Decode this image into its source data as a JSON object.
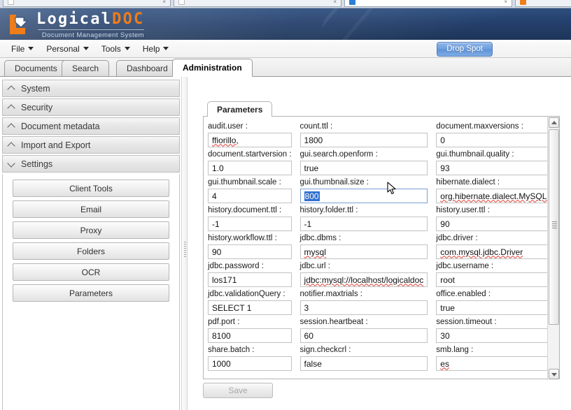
{
  "browser": {
    "tabs": [
      {
        "title": "",
        "favicon_color": "#ffffff",
        "active": false
      },
      {
        "title": "",
        "favicon_color": "#2a7fd4",
        "active": false
      },
      {
        "title": "",
        "favicon_color": "#ef7d1a",
        "active": true
      },
      {
        "title": "",
        "favicon_color": "#dddddd",
        "active": false
      }
    ]
  },
  "header": {
    "logo_word_1": "Logical",
    "logo_word_2": "DOC",
    "tagline": "Document Management System",
    "logo_icon": "logicaldoc-arrow-logo"
  },
  "menubar": {
    "items": [
      {
        "label": "File"
      },
      {
        "label": "Personal"
      },
      {
        "label": "Tools"
      },
      {
        "label": "Help"
      }
    ],
    "drop_spot_label": "Drop Spot"
  },
  "tabs": [
    {
      "label": "Documents",
      "active": false
    },
    {
      "label": "Search",
      "active": false
    },
    {
      "label": "Dashboard",
      "active": false
    },
    {
      "label": "Administration",
      "active": true
    }
  ],
  "sidebar": {
    "sections": [
      {
        "label": "System",
        "expanded": false
      },
      {
        "label": "Security",
        "expanded": false
      },
      {
        "label": "Document metadata",
        "expanded": false
      },
      {
        "label": "Import and Export",
        "expanded": false
      },
      {
        "label": "Settings",
        "expanded": true
      }
    ],
    "settings_buttons": [
      {
        "label": "Client Tools"
      },
      {
        "label": "Email"
      },
      {
        "label": "Proxy"
      },
      {
        "label": "Folders"
      },
      {
        "label": "OCR"
      },
      {
        "label": "Parameters"
      }
    ]
  },
  "panel": {
    "tab_label": "Parameters",
    "save_label": "Save",
    "fields": [
      {
        "label": "audit.user :",
        "value": "ffiorillo,",
        "spellcheck_flag": true,
        "focused": false,
        "selected": false
      },
      {
        "label": "count.ttl :",
        "value": "1800",
        "spellcheck_flag": false,
        "focused": false,
        "selected": false
      },
      {
        "label": "document.maxversions :",
        "value": "0",
        "spellcheck_flag": false,
        "focused": false,
        "selected": false
      },
      {
        "label": "document.startversion :",
        "value": "1.0",
        "spellcheck_flag": false,
        "focused": false,
        "selected": false
      },
      {
        "label": "gui.search.openform :",
        "value": "true",
        "spellcheck_flag": false,
        "focused": false,
        "selected": false
      },
      {
        "label": "gui.thumbnail.quality :",
        "value": "93",
        "spellcheck_flag": false,
        "focused": false,
        "selected": false
      },
      {
        "label": "gui.thumbnail.scale :",
        "value": "4",
        "spellcheck_flag": false,
        "focused": false,
        "selected": false
      },
      {
        "label": "gui.thumbnail.size :",
        "value": "800",
        "spellcheck_flag": false,
        "focused": true,
        "selected": true
      },
      {
        "label": "hibernate.dialect :",
        "value": "org.hibernate.dialect.MySQLDialect",
        "spellcheck_flag": true,
        "focused": false,
        "selected": false
      },
      {
        "label": "history.document.ttl :",
        "value": "-1",
        "spellcheck_flag": false,
        "focused": false,
        "selected": false
      },
      {
        "label": "history.folder.ttl :",
        "value": "-1",
        "spellcheck_flag": false,
        "focused": false,
        "selected": false
      },
      {
        "label": "history.user.ttl :",
        "value": "90",
        "spellcheck_flag": false,
        "focused": false,
        "selected": false
      },
      {
        "label": "history.workflow.ttl :",
        "value": "90",
        "spellcheck_flag": false,
        "focused": false,
        "selected": false
      },
      {
        "label": "jdbc.dbms :",
        "value": "mysql",
        "spellcheck_flag": true,
        "focused": false,
        "selected": false
      },
      {
        "label": "jdbc.driver :",
        "value": "com.mysql.jdbc.Driver",
        "spellcheck_flag": true,
        "focused": false,
        "selected": false
      },
      {
        "label": "jdbc.password :",
        "value": "los171",
        "spellcheck_flag": false,
        "focused": false,
        "selected": false
      },
      {
        "label": "jdbc.url :",
        "value": "jdbc:mysql://localhost/logicaldoc",
        "spellcheck_flag": true,
        "focused": false,
        "selected": false
      },
      {
        "label": "jdbc.username :",
        "value": "root",
        "spellcheck_flag": false,
        "focused": false,
        "selected": false
      },
      {
        "label": "jdbc.validationQuery :",
        "value": "SELECT 1",
        "spellcheck_flag": false,
        "focused": false,
        "selected": false
      },
      {
        "label": "notifier.maxtrials :",
        "value": "3",
        "spellcheck_flag": false,
        "focused": false,
        "selected": false
      },
      {
        "label": "office.enabled :",
        "value": "true",
        "spellcheck_flag": false,
        "focused": false,
        "selected": false
      },
      {
        "label": "pdf.port :",
        "value": "8100",
        "spellcheck_flag": false,
        "focused": false,
        "selected": false
      },
      {
        "label": "session.heartbeat :",
        "value": "60",
        "spellcheck_flag": false,
        "focused": false,
        "selected": false
      },
      {
        "label": "session.timeout :",
        "value": "30",
        "spellcheck_flag": false,
        "focused": false,
        "selected": false
      },
      {
        "label": "share.batch :",
        "value": "1000",
        "spellcheck_flag": false,
        "focused": false,
        "selected": false
      },
      {
        "label": "sign.checkcrl :",
        "value": "false",
        "spellcheck_flag": false,
        "focused": false,
        "selected": false
      },
      {
        "label": "smb.lang :",
        "value": "es",
        "spellcheck_flag": true,
        "focused": false,
        "selected": false
      }
    ]
  },
  "colors": {
    "header_blue": "#24406c",
    "logo_orange": "#ef7d1a",
    "selection_blue": "#2f6fd0",
    "spellcheck_red": "#e03a2f"
  }
}
